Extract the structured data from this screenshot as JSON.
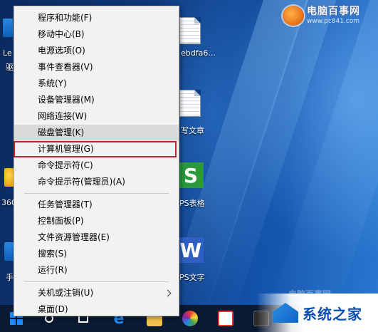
{
  "desktop": {
    "icons": {
      "doc1_label": "ebdfa6...",
      "doc2_label": "写文章",
      "wps_sheet_label": "PS表格",
      "wps_word_label": "PS文字",
      "left_label_1": "Le",
      "left_label_2": "驱",
      "left_label_3": "360",
      "left_label_4": "手"
    },
    "watermark_top": {
      "title": "电脑百事网",
      "url": "www.pc841.com"
    },
    "watermark_bottom": "电脑百事网"
  },
  "context_menu": {
    "items": [
      {
        "label": "程序和功能(F)"
      },
      {
        "label": "移动中心(B)"
      },
      {
        "label": "电源选项(O)"
      },
      {
        "label": "事件查看器(V)"
      },
      {
        "label": "系统(Y)"
      },
      {
        "label": "设备管理器(M)"
      },
      {
        "label": "网络连接(W)"
      },
      {
        "label": "磁盘管理(K)",
        "state": "hover"
      },
      {
        "label": "计算机管理(G)",
        "state": "highlighted-red-box"
      },
      {
        "label": "命令提示符(C)"
      },
      {
        "label": "命令提示符(管理员)(A)"
      },
      {
        "label": "任务管理器(T)"
      },
      {
        "label": "控制面板(P)"
      },
      {
        "label": "文件资源管理器(E)"
      },
      {
        "label": "搜索(S)"
      },
      {
        "label": "运行(R)"
      },
      {
        "label": "关机或注销(U)",
        "has_submenu": true
      },
      {
        "label": "桌面(D)"
      }
    ],
    "highlight_color": "#c0272d"
  },
  "taskbar": {
    "icons": [
      "windows-start-icon",
      "search-icon",
      "task-view-icon",
      "edge-icon",
      "file-explorer-icon",
      "store-icon",
      "color-wheel-app-icon",
      "browser-app-icon",
      "app-icon"
    ]
  },
  "bottom_badge": {
    "text": "系统之家"
  }
}
